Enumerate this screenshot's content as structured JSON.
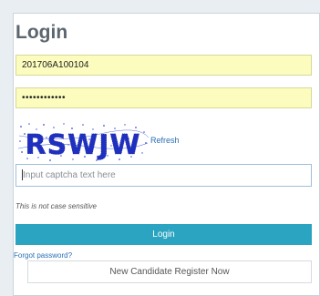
{
  "login": {
    "title": "Login",
    "username_value": "201706A100104",
    "password_value": "••••••••••••",
    "captcha_text": "RSWJW",
    "refresh_label": "Refresh",
    "captcha_placeholder": "Input captcha text here",
    "case_hint": "This is not case sensitive",
    "login_label": "Login",
    "forgot_label": "Forgot password?",
    "register_label": "New Candidate Register Now"
  },
  "colors": {
    "accent": "#2aa4c0",
    "field_highlight": "#fbfcbe",
    "link": "#2a6fb5",
    "captcha_ink": "#1f2fbf"
  }
}
